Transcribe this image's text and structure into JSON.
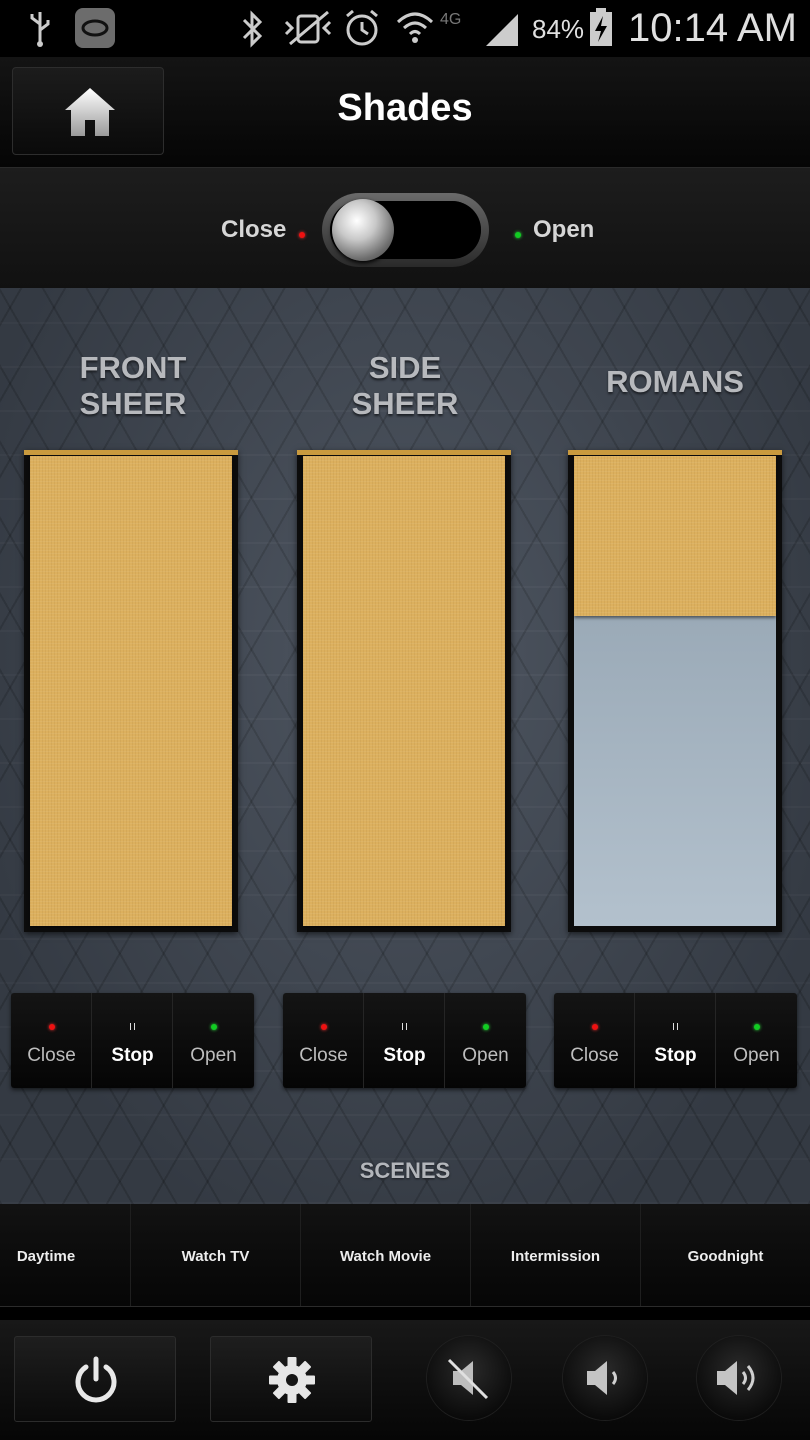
{
  "status_bar": {
    "battery_percent": "84%",
    "time": "10:14 AM"
  },
  "header": {
    "title": "Shades"
  },
  "master_toggle": {
    "close_label": "Close",
    "open_label": "Open",
    "state": "close"
  },
  "shades": [
    {
      "title": "FRONT\nSHEER",
      "closed_fraction": 1.0,
      "buttons": {
        "close": "Close",
        "stop": "Stop",
        "open": "Open"
      }
    },
    {
      "title": "SIDE\nSHEER",
      "closed_fraction": 1.0,
      "buttons": {
        "close": "Close",
        "stop": "Stop",
        "open": "Open"
      }
    },
    {
      "title": "ROMANS",
      "closed_fraction": 0.34,
      "buttons": {
        "close": "Close",
        "stop": "Stop",
        "open": "Open"
      }
    }
  ],
  "scenes": {
    "title": "SCENES",
    "items": [
      "Daytime",
      "Watch TV",
      "Watch Movie",
      "Intermission",
      "Goodnight"
    ]
  },
  "footer": {
    "icons": [
      "power-icon",
      "gear-icon",
      "mute-icon",
      "volume-down-icon",
      "volume-up-icon"
    ]
  },
  "colors": {
    "fabric": "#dcb05e",
    "rail": "#c99a3e",
    "indicator_red": "#ee1111",
    "indicator_green": "#11cc22"
  }
}
